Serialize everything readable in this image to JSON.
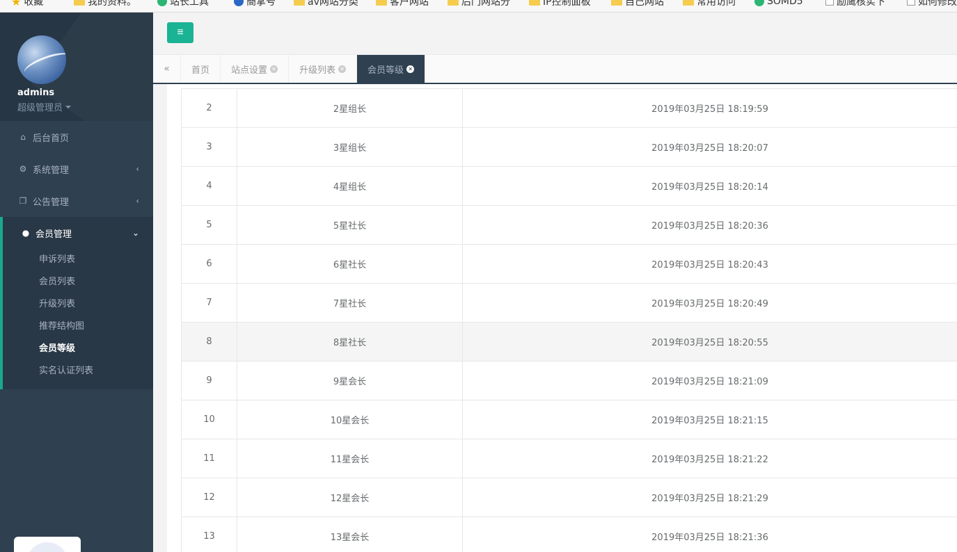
{
  "bookmarks": [
    {
      "label": "收藏",
      "icon": "star-icon"
    },
    {
      "label": "我的资料。",
      "icon": "folder-icon"
    },
    {
      "label": "站长工具",
      "icon": "tool-icon"
    },
    {
      "label": "簡掌号",
      "icon": "baidu-icon"
    },
    {
      "label": "av网站分类",
      "icon": "folder-icon"
    },
    {
      "label": "客户网站",
      "icon": "folder-icon"
    },
    {
      "label": "后门网站分",
      "icon": "folder-icon"
    },
    {
      "label": "IP控制面板",
      "icon": "folder-icon"
    },
    {
      "label": "自己网站",
      "icon": "folder-icon"
    },
    {
      "label": "常用访问",
      "icon": "folder-icon"
    },
    {
      "label": "SOMD5",
      "icon": "somd5-icon"
    },
    {
      "label": "励鹰核实下",
      "icon": "checkbox-icon"
    },
    {
      "label": "如何修改",
      "icon": "checkbox-icon"
    }
  ],
  "profile": {
    "name": "admins",
    "role": "超级管理员"
  },
  "sidebar": {
    "items": [
      {
        "label": "后台首页",
        "icon": "home-icon"
      },
      {
        "label": "系统管理",
        "icon": "gear-icon"
      },
      {
        "label": "公告管理",
        "icon": "copy-icon"
      },
      {
        "label": "会员管理",
        "icon": "user-icon"
      }
    ],
    "submenu": [
      "申诉列表",
      "会员列表",
      "升级列表",
      "推荐结构图",
      "会员等级",
      "实名认证列表"
    ]
  },
  "header": {
    "menu_toggle": "≡"
  },
  "tabs": [
    "首页",
    "站点设置",
    "升级列表",
    "会员等级"
  ],
  "table": {
    "rows": [
      {
        "id": "2",
        "name": "2星组长",
        "time": "2019年03月25日 18:19:59"
      },
      {
        "id": "3",
        "name": "3星组长",
        "time": "2019年03月25日 18:20:07"
      },
      {
        "id": "4",
        "name": "4星组长",
        "time": "2019年03月25日 18:20:14"
      },
      {
        "id": "5",
        "name": "5星社长",
        "time": "2019年03月25日 18:20:36"
      },
      {
        "id": "6",
        "name": "6星社长",
        "time": "2019年03月25日 18:20:43"
      },
      {
        "id": "7",
        "name": "7星社长",
        "time": "2019年03月25日 18:20:49"
      },
      {
        "id": "8",
        "name": "8星社长",
        "time": "2019年03月25日 18:20:55"
      },
      {
        "id": "9",
        "name": "9星会长",
        "time": "2019年03月25日 18:21:09"
      },
      {
        "id": "10",
        "name": "10星会长",
        "time": "2019年03月25日 18:21:15"
      },
      {
        "id": "11",
        "name": "11星会长",
        "time": "2019年03月25日 18:21:22"
      },
      {
        "id": "12",
        "name": "12星会长",
        "time": "2019年03月25日 18:21:29"
      },
      {
        "id": "13",
        "name": "13星会长",
        "time": "2019年03月25日 18:21:36"
      }
    ]
  },
  "colors": {
    "sidebar": "#2f4050",
    "accent": "#1ab394",
    "active_border": "#19aa8d"
  }
}
